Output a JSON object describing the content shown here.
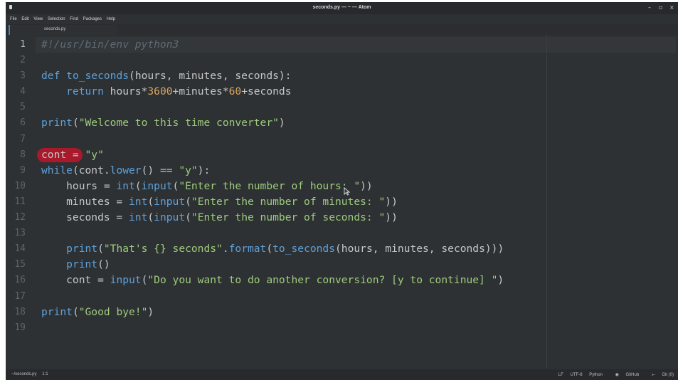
{
  "window": {
    "title": "seconds.py — ~ — Atom",
    "controls": [
      "–",
      "▫",
      "×"
    ]
  },
  "menu": [
    "File",
    "Edit",
    "View",
    "Selection",
    "Find",
    "Packages",
    "Help"
  ],
  "tab": {
    "label": "seconds.py"
  },
  "editor": {
    "current_line": 1,
    "line_numbers": [
      "1",
      "2",
      "3",
      "4",
      "5",
      "6",
      "7",
      "8",
      "9",
      "10",
      "11",
      "12",
      "13",
      "14",
      "15",
      "16",
      "17",
      "18",
      "19"
    ],
    "lines": [
      [
        {
          "t": "cmt",
          "v": "#!/usr/bin/env python3"
        }
      ],
      [],
      [
        {
          "t": "kw",
          "v": "def "
        },
        {
          "t": "fn",
          "v": "to_seconds"
        },
        {
          "t": "txt",
          "v": "(hours, minutes, seconds):"
        }
      ],
      [
        {
          "t": "txt",
          "v": "    "
        },
        {
          "t": "kw",
          "v": "return "
        },
        {
          "t": "txt",
          "v": "hours*"
        },
        {
          "t": "num",
          "v": "3600"
        },
        {
          "t": "txt",
          "v": "+minutes*"
        },
        {
          "t": "num",
          "v": "60"
        },
        {
          "t": "txt",
          "v": "+seconds"
        }
      ],
      [],
      [
        {
          "t": "kw",
          "v": "print"
        },
        {
          "t": "txt",
          "v": "("
        },
        {
          "t": "str",
          "v": "\"Welcome to this time converter\""
        },
        {
          "t": "txt",
          "v": ")"
        }
      ],
      [],
      [
        {
          "t": "txt",
          "v": "cont = "
        },
        {
          "t": "str",
          "v": "\"y\""
        }
      ],
      [
        {
          "t": "kw",
          "v": "while"
        },
        {
          "t": "txt",
          "v": "(cont."
        },
        {
          "t": "fn",
          "v": "lower"
        },
        {
          "t": "txt",
          "v": "() == "
        },
        {
          "t": "str",
          "v": "\"y\""
        },
        {
          "t": "txt",
          "v": "):"
        }
      ],
      [
        {
          "t": "txt",
          "v": "    hours = "
        },
        {
          "t": "fn",
          "v": "int"
        },
        {
          "t": "txt",
          "v": "("
        },
        {
          "t": "fn",
          "v": "input"
        },
        {
          "t": "txt",
          "v": "("
        },
        {
          "t": "str",
          "v": "\"Enter the number of hours: \""
        },
        {
          "t": "txt",
          "v": "))"
        }
      ],
      [
        {
          "t": "txt",
          "v": "    minutes = "
        },
        {
          "t": "fn",
          "v": "int"
        },
        {
          "t": "txt",
          "v": "("
        },
        {
          "t": "fn",
          "v": "input"
        },
        {
          "t": "txt",
          "v": "("
        },
        {
          "t": "str",
          "v": "\"Enter the number of minutes: \""
        },
        {
          "t": "txt",
          "v": "))"
        }
      ],
      [
        {
          "t": "txt",
          "v": "    seconds = "
        },
        {
          "t": "fn",
          "v": "int"
        },
        {
          "t": "txt",
          "v": "("
        },
        {
          "t": "fn",
          "v": "input"
        },
        {
          "t": "txt",
          "v": "("
        },
        {
          "t": "str",
          "v": "\"Enter the number of seconds: \""
        },
        {
          "t": "txt",
          "v": "))"
        }
      ],
      [],
      [
        {
          "t": "txt",
          "v": "    "
        },
        {
          "t": "kw",
          "v": "print"
        },
        {
          "t": "txt",
          "v": "("
        },
        {
          "t": "str",
          "v": "\"That's {} seconds\""
        },
        {
          "t": "txt",
          "v": "."
        },
        {
          "t": "fn",
          "v": "format"
        },
        {
          "t": "txt",
          "v": "("
        },
        {
          "t": "fn",
          "v": "to_seconds"
        },
        {
          "t": "txt",
          "v": "(hours, minutes, seconds)))"
        }
      ],
      [
        {
          "t": "txt",
          "v": "    "
        },
        {
          "t": "kw",
          "v": "print"
        },
        {
          "t": "txt",
          "v": "()"
        }
      ],
      [
        {
          "t": "txt",
          "v": "    cont = "
        },
        {
          "t": "fn",
          "v": "input"
        },
        {
          "t": "txt",
          "v": "("
        },
        {
          "t": "str",
          "v": "\"Do you want to do another conversion? [y to continue] \""
        },
        {
          "t": "txt",
          "v": ")"
        }
      ],
      [],
      [
        {
          "t": "kw",
          "v": "print"
        },
        {
          "t": "txt",
          "v": "("
        },
        {
          "t": "str",
          "v": "\"Good bye!\""
        },
        {
          "t": "txt",
          "v": ")"
        }
      ],
      []
    ],
    "highlighted_line": 8
  },
  "status": {
    "file": "~/seconds.py",
    "cursor": "1:1",
    "line_ending": "LF",
    "encoding": "UTF-8",
    "grammar": "Python",
    "github": "GitHub",
    "git": "Git (0)"
  },
  "colors": {
    "background": "#2e3134",
    "keyword": "#5ea0d8",
    "string": "#9ecb7b",
    "number": "#d7a65f",
    "highlight": "#b3172a"
  }
}
